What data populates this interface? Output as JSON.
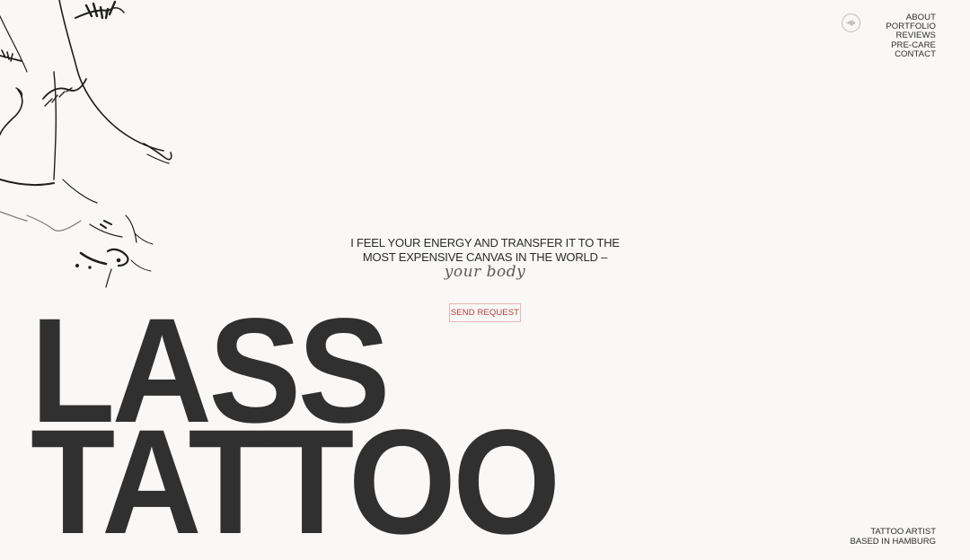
{
  "nav": {
    "items": [
      "ABOUT",
      "PORTFOLIO",
      "REVIEWS",
      "PRE-CARE",
      "CONTACT"
    ],
    "sound_icon": "sound-wave-icon"
  },
  "tagline": {
    "line1": "I FEEL YOUR ENERGY AND TRANSFER IT TO THE",
    "line2": "MOST EXPENSIVE CANVAS IN THE WORLD –",
    "script": "your body"
  },
  "cta": {
    "label": "SEND REQUEST"
  },
  "hero": {
    "line1": "LASS",
    "line2": "TATTOO"
  },
  "footer": {
    "line1": "TATTOO ARTIST",
    "line2": "BASED IN HAMBURG"
  },
  "colors": {
    "background": "#f9f8f6",
    "text": "#2b2b2b",
    "accent": "#b43c3c"
  }
}
